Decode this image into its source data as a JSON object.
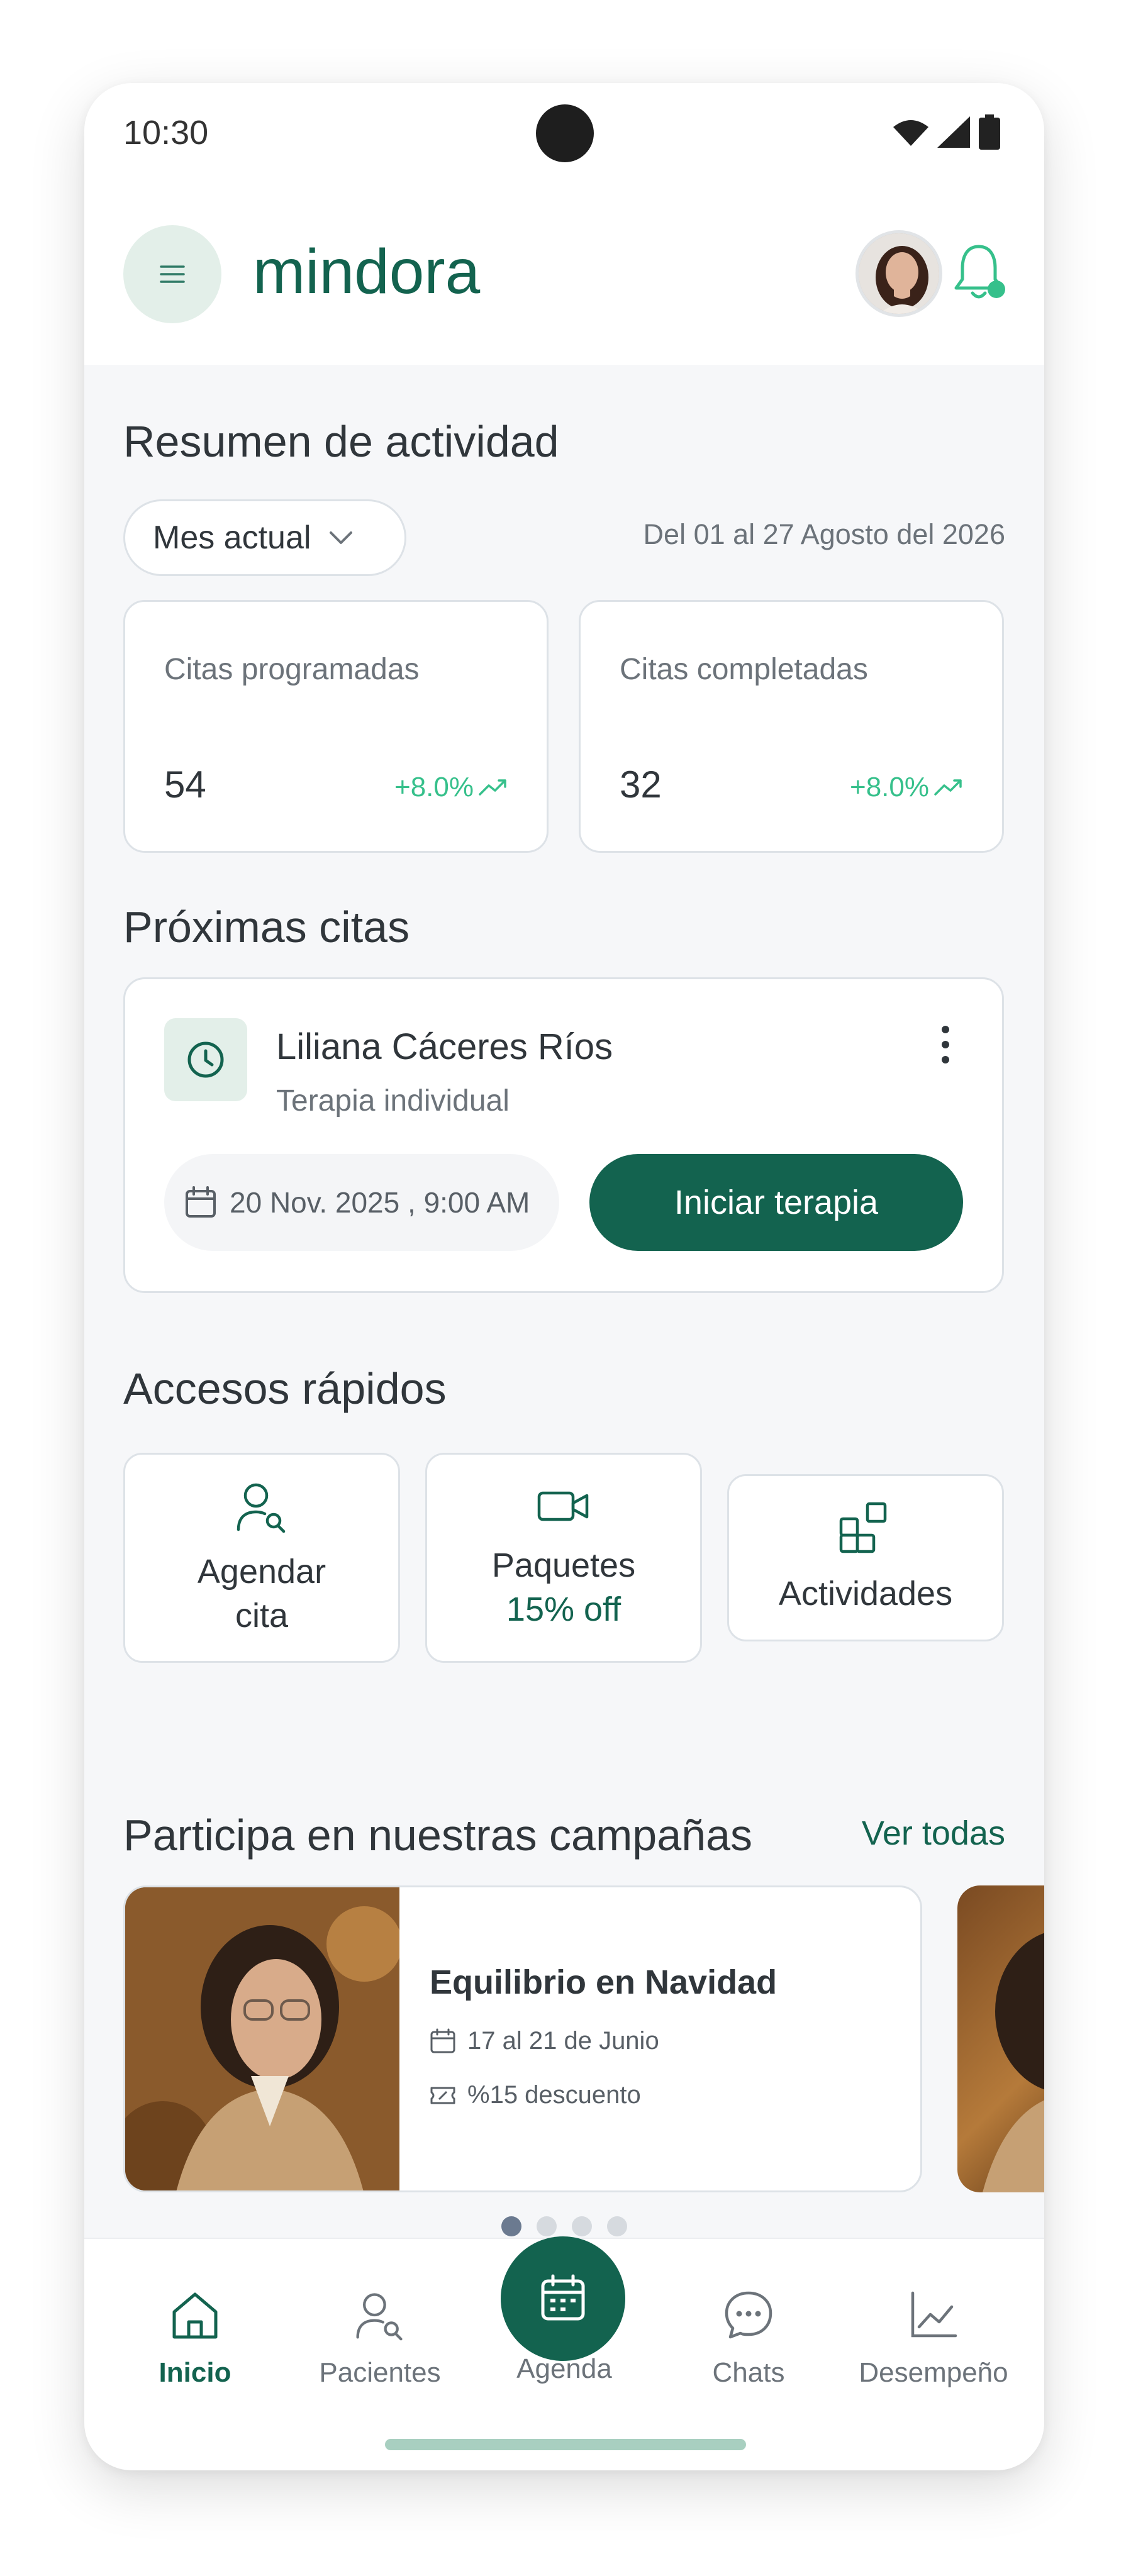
{
  "status_bar": {
    "time": "10:30"
  },
  "header": {
    "logo_text": "mindora",
    "menu_icon": "hamburger-icon",
    "bell_icon": "bell-icon"
  },
  "summary": {
    "title": "Resumen de actividad",
    "period_select": "Mes actual",
    "date_range": "Del 01 al 27 Agosto del 2026",
    "stats": [
      {
        "label": "Citas programadas",
        "value": "54",
        "delta": "+8.0%"
      },
      {
        "label": "Citas completadas",
        "value": "32",
        "delta": "+8.0%"
      }
    ]
  },
  "upcoming": {
    "title": "Próximas citas",
    "appointment": {
      "name": "Liliana Cáceres Ríos",
      "type": "Terapia individual",
      "datetime": "20 Nov. 2025 , 9:00 AM",
      "action_label": "Iniciar terapia"
    }
  },
  "quick_access": {
    "title": "Accesos rápidos",
    "items": [
      {
        "label": "Agendar cita",
        "icon": "user-search-icon"
      },
      {
        "label": "Paquetes",
        "sub": "15% off",
        "icon": "video-icon"
      },
      {
        "label": "Actividades",
        "icon": "grid-plus-icon"
      }
    ]
  },
  "campaigns": {
    "title": "Participa en nuestras campañas",
    "see_all": "Ver todas",
    "items": [
      {
        "title": "Equilibrio en Navidad",
        "dates": "17 al 21 de Junio",
        "discount": "%15 descuento"
      }
    ],
    "pagination": {
      "count": 4,
      "active": 1
    }
  },
  "bottom_nav": {
    "items": [
      {
        "label": "Inicio",
        "active": true
      },
      {
        "label": "Pacientes"
      },
      {
        "label": "Agenda"
      },
      {
        "label": "Chats"
      },
      {
        "label": "Desempeño"
      }
    ]
  },
  "colors": {
    "brand": "#13634f",
    "accent": "#36c08b",
    "muted_bg": "#e3efe9"
  }
}
